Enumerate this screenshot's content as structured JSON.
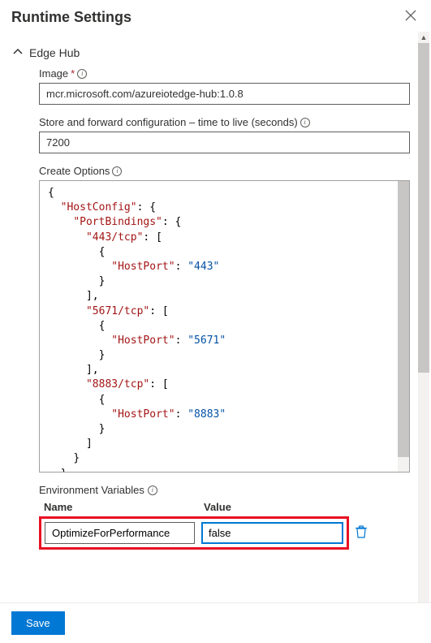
{
  "panel": {
    "title": "Runtime Settings"
  },
  "section": {
    "title": "Edge Hub"
  },
  "fields": {
    "image": {
      "label": "Image",
      "required_marker": "*",
      "value": "mcr.microsoft.com/azureiotedge-hub:1.0.8"
    },
    "ttl": {
      "label": "Store and forward configuration – time to live (seconds)",
      "value": "7200"
    },
    "createOptions": {
      "label": "Create Options",
      "json": {
        "HostConfig": {
          "PortBindings": {
            "443/tcp": [
              {
                "HostPort": "443"
              }
            ],
            "5671/tcp": [
              {
                "HostPort": "5671"
              }
            ],
            "8883/tcp": [
              {
                "HostPort": "8883"
              }
            ]
          }
        }
      }
    }
  },
  "envVars": {
    "heading": "Environment Variables",
    "cols": {
      "name": "Name",
      "value": "Value"
    },
    "rows": [
      {
        "name": "OptimizeForPerformance",
        "value": "false"
      }
    ]
  },
  "footer": {
    "save": "Save"
  }
}
